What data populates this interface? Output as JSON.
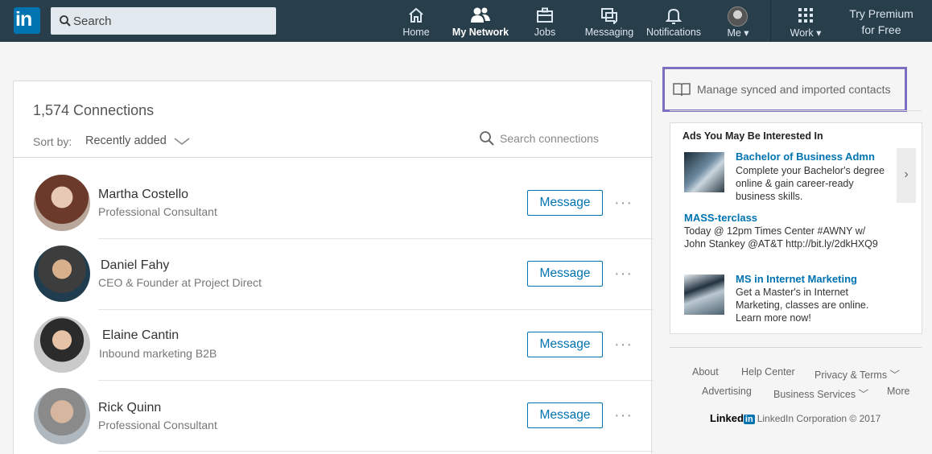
{
  "nav": {
    "logo_text": "in",
    "search_placeholder": "Search",
    "items": [
      {
        "label": "Home",
        "icon": "home-icon"
      },
      {
        "label": "My Network",
        "icon": "network-icon"
      },
      {
        "label": "Jobs",
        "icon": "briefcase-icon"
      },
      {
        "label": "Messaging",
        "icon": "messaging-icon"
      },
      {
        "label": "Notifications",
        "icon": "bell-icon"
      },
      {
        "label": "Me",
        "icon": "avatar-icon"
      },
      {
        "label": "Work",
        "icon": "grid-icon"
      }
    ],
    "premium_line1": "Try Premium",
    "premium_line2": "for Free"
  },
  "connections": {
    "count_text": "1,574 Connections",
    "sort_label": "Sort by:",
    "sort_value": "Recently added",
    "search_placeholder": "Search connections",
    "message_label": "Message",
    "more_label": "···",
    "people": [
      {
        "name": "Martha Costello",
        "title": "Professional Consultant"
      },
      {
        "name": "Daniel Fahy",
        "title": "CEO & Founder at Project Direct"
      },
      {
        "name": "Elaine Cantin",
        "title": "Inbound marketing B2B"
      },
      {
        "name": "Rick Quinn",
        "title": "Professional Consultant"
      }
    ]
  },
  "sidebar": {
    "manage_contacts": "Manage synced and imported contacts",
    "ads_heading": "Ads You May Be Interested In",
    "ads": [
      {
        "title": "Bachelor of Business Admn",
        "body": "Complete your Bachelor's degree online & gain career-ready business skills."
      },
      {
        "title": "MASS-terclass",
        "body": "Today @ 12pm Times Center #AWNY w/ John Stankey @AT&T http://bit.ly/2dkHXQ9"
      },
      {
        "title": "MS in Internet Marketing",
        "body": "Get a Master's in Internet Marketing, classes are online. Learn more now!"
      }
    ],
    "next_arrow": "›"
  },
  "footer": {
    "links": [
      "About",
      "Help Center",
      "Privacy & Terms",
      "Advertising",
      "Business Services",
      "More"
    ],
    "wordmark": "Linked",
    "wordmark_in": "in",
    "copyright": "LinkedIn Corporation © 2017"
  },
  "colors": {
    "nav_bg": "#283e4a",
    "brand_blue": "#0073b1",
    "highlight_border": "#7d6fc0"
  }
}
